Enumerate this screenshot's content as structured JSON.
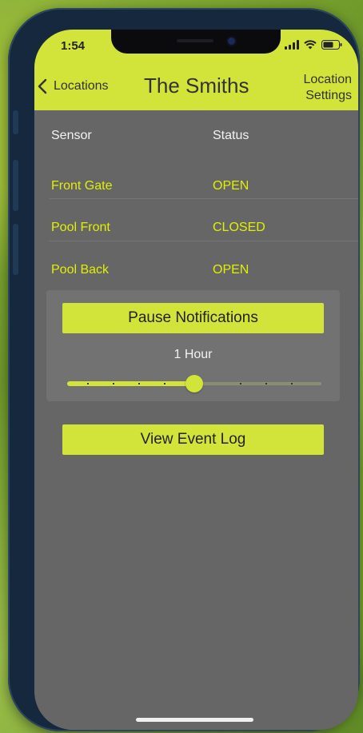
{
  "status_bar": {
    "time": "1:54",
    "signal_icon": "cellular-signal-icon",
    "wifi_icon": "wifi-icon",
    "battery_icon": "battery-icon"
  },
  "nav": {
    "back_label": "Locations",
    "back_icon": "chevron-left-icon",
    "title": "The Smiths",
    "settings_line1": "Location",
    "settings_line2": "Settings"
  },
  "table": {
    "headers": {
      "sensor": "Sensor",
      "status": "Status"
    },
    "rows": [
      {
        "sensor": "Front Gate",
        "status": "OPEN"
      },
      {
        "sensor": "Pool Front",
        "status": "CLOSED"
      },
      {
        "sensor": "Pool Back",
        "status": "OPEN"
      }
    ]
  },
  "pause": {
    "button_label": "Pause Notifications",
    "duration_label": "1 Hour",
    "slider_value_fraction": 0.5
  },
  "event_log": {
    "button_label": "View Event Log"
  },
  "colors": {
    "accent": "#d2e33a",
    "sensor_text": "#e2f000",
    "screen_bg": "#666666",
    "panel_bg": "#727272"
  }
}
